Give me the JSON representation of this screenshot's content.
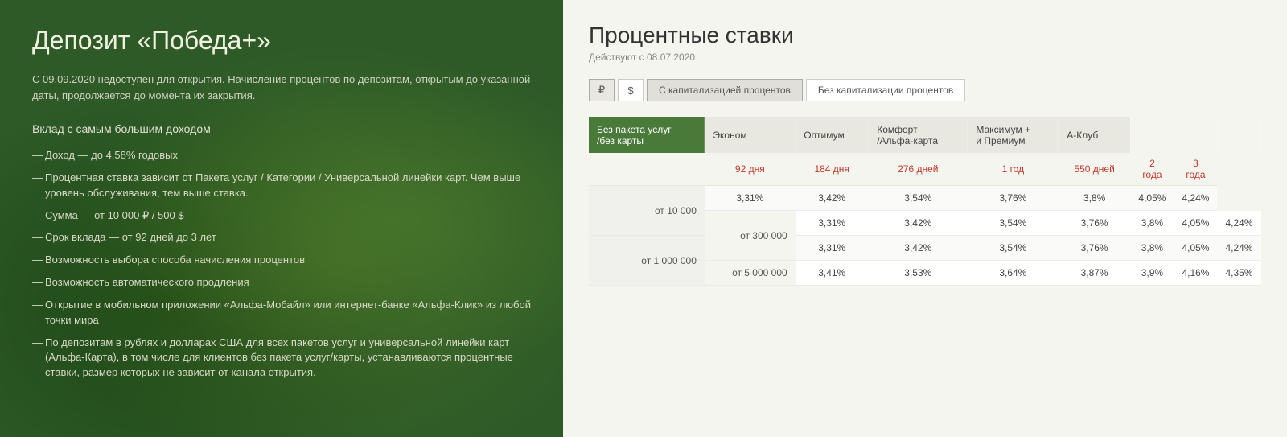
{
  "left": {
    "title": "Депозит «Победа+»",
    "subtitle": "С 09.09.2020 недоступен для открытия. Начисление процентов по депозитам, открытым до указанной даты, продолжается до момента их закрытия.",
    "vklad_label": "Вклад с самым большим доходом",
    "features": [
      {
        "text": "Доход — до 4,58% годовых"
      },
      {
        "text": "Процентная ставка зависит от Пакета услуг / Категории / Универсальной линейки карт. Чем выше уровень обслуживания, тем выше ставка."
      },
      {
        "text": "Сумма — от 10 000 ₽ / 500 $"
      },
      {
        "text": "Срок вклада — от 92 дней до 3 лет"
      },
      {
        "text": "Возможность выбора способа начисления процентов"
      },
      {
        "text": "Возможность автоматического продления"
      },
      {
        "text": "Открытие в мобильном приложении «Альфа-Мобайл» или интернет-банке «Альфа-Клик» из любой точки мира"
      },
      {
        "text": "По депозитам в рублях и долларах США для всех пакетов услуг и универсальной линейки карт (Альфа-Карта), в том числе для клиентов без пакета услуг/карты, устанавливаются процентные ставки, размер которых не зависит от канала открытия."
      }
    ]
  },
  "right": {
    "title": "Процентные ставки",
    "subtitle": "Действуют с 08.07.2020",
    "currency_buttons": [
      {
        "label": "₽",
        "active": true
      },
      {
        "label": "$",
        "active": false
      }
    ],
    "tab_buttons": [
      {
        "label": "С капитализацией процентов",
        "active": true
      },
      {
        "label": "Без капитализации процентов",
        "active": false
      }
    ],
    "col_headers": [
      {
        "label": "Без пакета услуг\n/без карты",
        "type": "dark"
      },
      {
        "label": "Эконом",
        "type": "light"
      },
      {
        "label": "Оптимум",
        "type": "light"
      },
      {
        "label": "Комфорт\n/Альфа-карта",
        "type": "light"
      },
      {
        "label": "Максимум +\nи Премиум",
        "type": "light"
      },
      {
        "label": "А-Клуб",
        "type": "light"
      }
    ],
    "period_labels": [
      "92 дня",
      "184 дня",
      "276 дней",
      "1 год",
      "550 дней",
      "2 года",
      "3 года"
    ],
    "rows": [
      {
        "amount": "от 10 000",
        "values": [
          "3,31%",
          "3,42%",
          "3,54%",
          "3,76%",
          "3,8%",
          "4,05%",
          "4,24%"
        ]
      },
      {
        "amount": "от 300 000",
        "values": [
          "3,31%",
          "3,42%",
          "3,54%",
          "3,76%",
          "3,8%",
          "4,05%",
          "4,24%"
        ]
      },
      {
        "amount": "от 1 000 000",
        "values": [
          "3,31%",
          "3,42%",
          "3,54%",
          "3,76%",
          "3,8%",
          "4,05%",
          "4,24%"
        ]
      },
      {
        "amount": "от 5 000 000",
        "values": [
          "3,41%",
          "3,53%",
          "3,64%",
          "3,87%",
          "3,9%",
          "4,16%",
          "4,35%"
        ]
      }
    ]
  }
}
